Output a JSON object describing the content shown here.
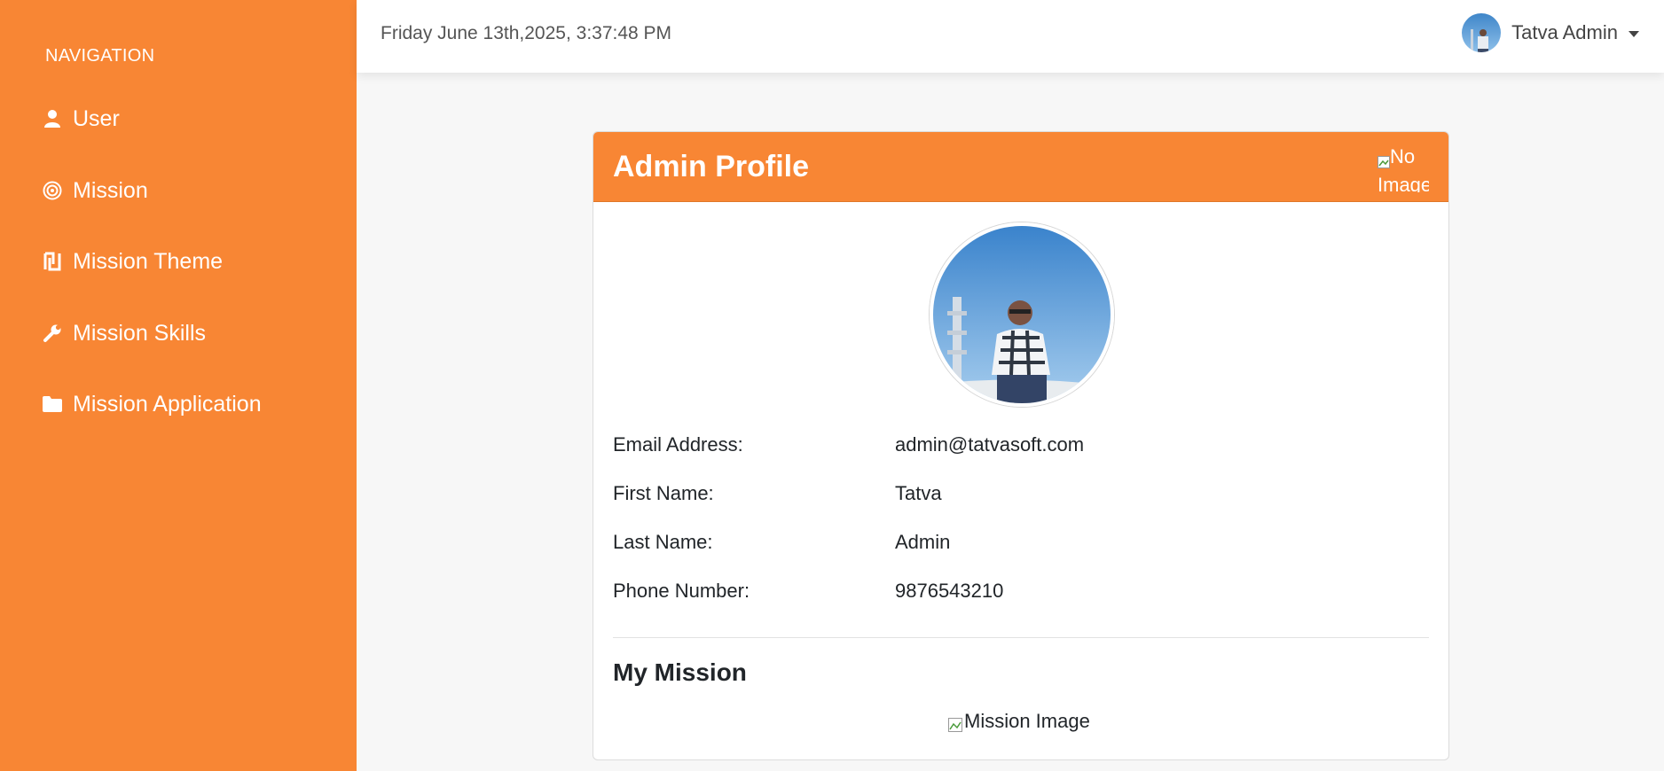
{
  "sidebar": {
    "heading": "NAVIGATION",
    "items": [
      {
        "label": "User",
        "icon": "user-icon"
      },
      {
        "label": "Mission",
        "icon": "target-icon"
      },
      {
        "label": "Mission Theme",
        "icon": "theme-icon"
      },
      {
        "label": "Mission Skills",
        "icon": "wrench-icon"
      },
      {
        "label": "Mission Application",
        "icon": "folder-icon"
      }
    ]
  },
  "topbar": {
    "datetime": "Friday June 13th,2025, 3:37:48 PM",
    "user_name": "Tatva Admin"
  },
  "profile": {
    "title": "Admin Profile",
    "header_image_alt": "No Image",
    "fields": [
      {
        "label": "Email Address:",
        "value": "admin@tatvasoft.com"
      },
      {
        "label": "First Name:",
        "value": "Tatva"
      },
      {
        "label": "Last Name:",
        "value": "Admin"
      },
      {
        "label": "Phone Number:",
        "value": "9876543210"
      }
    ],
    "section_title": "My Mission",
    "mission_image_alt": "Mission Image"
  },
  "colors": {
    "accent": "#f88634",
    "background": "#f7f7f7"
  }
}
